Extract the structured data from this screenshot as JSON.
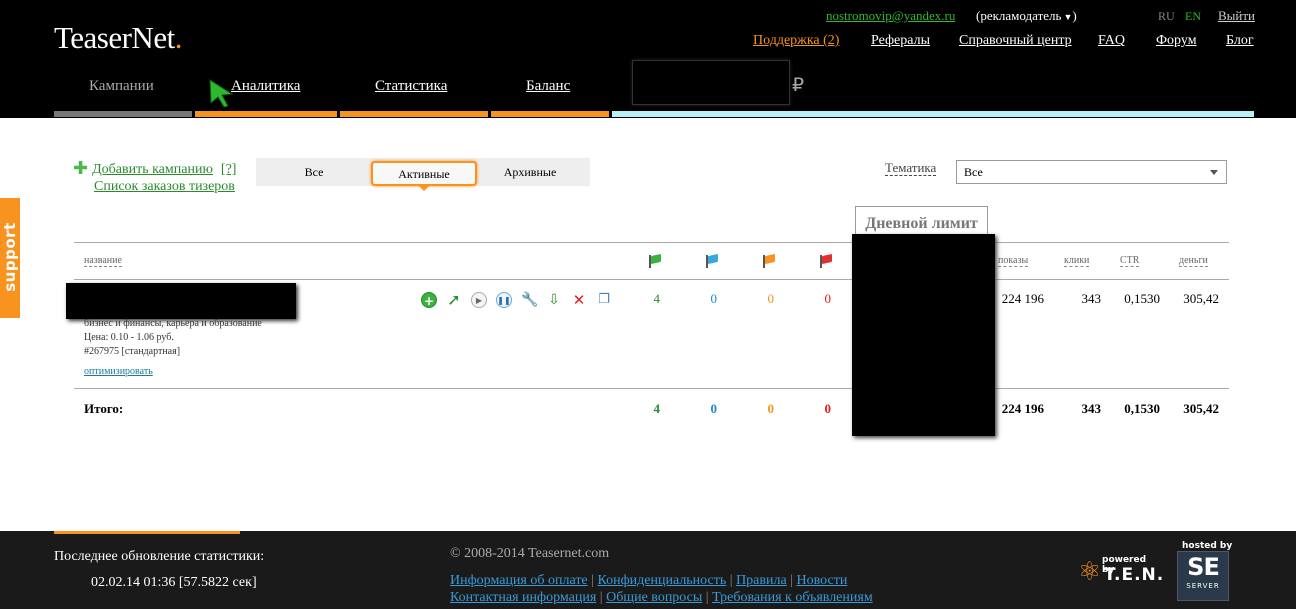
{
  "header": {
    "logo": "TeaserNet",
    "logo_dot": ".",
    "user_email": "nostromovip@yandex.ru",
    "role": "рекламодатель",
    "lang_ru": "RU",
    "lang_en": "EN",
    "logout": "Выйти",
    "top_nav": {
      "support": "Поддержка (2)",
      "referrals": "Рефералы",
      "help_center": "Справочный центр",
      "faq": "FAQ",
      "forum": "Форум",
      "blog": "Блог"
    },
    "tabs": {
      "campaigns": "Кампании",
      "analytics": "Аналитика",
      "statistics": "Статистика",
      "balance": "Баланс"
    },
    "currency_sign": "₽"
  },
  "support_tab": "support",
  "toolbar": {
    "add_campaign": "Добавить кампанию",
    "help": "[?]",
    "teaser_orders": "Список заказов тизеров",
    "filters": {
      "all": "Все",
      "active": "Активные",
      "archive": "Архивные"
    },
    "topic_label": "Тематика",
    "topic_value": "Все"
  },
  "table": {
    "daily_limit_header": "Дневной лимит",
    "columns": {
      "name": "название",
      "shows": "показы",
      "clicks": "клики",
      "ctr": "CTR",
      "money": "деньги"
    },
    "row": {
      "topic": "бизнес и финансы, карьера и образование",
      "price": "Цена: 0.10 - 1.06 руб.",
      "id": "#267975 [стандартная]",
      "optimize": "оптимизировать",
      "green": "4",
      "blue": "0",
      "orange": "0",
      "red": "0",
      "shows": "224 196",
      "clicks": "343",
      "ctr": "0,1530",
      "money": "305,42"
    },
    "total": {
      "label": "Итого:",
      "green": "4",
      "blue": "0",
      "orange": "0",
      "red": "0",
      "shows": "224 196",
      "clicks": "343",
      "ctr": "0,1530",
      "money": "305,42"
    }
  },
  "footer": {
    "last_update_label": "Последнее обновление статистики:",
    "last_update_value": "02.02.14 01:36 [57.5822 сек]",
    "copyright": "© 2008-2014 Teasernet.com",
    "links_row1": [
      "Информация об оплате",
      "Конфиденциальность",
      "Правила",
      "Новости"
    ],
    "links_row2": [
      "Контактная информация",
      "Общие вопросы",
      "Требования к объявлениям"
    ],
    "powered_small": "powered by",
    "powered_ten": "T.E.N.",
    "hosted_by": "hosted by",
    "server_big": "SE",
    "server_small": "SERVER"
  },
  "colors": {
    "accent": "#f7931e",
    "green": "#2a8b2a",
    "blue": "#1a8ac8",
    "red": "#e02020",
    "header_bg": "#000000"
  }
}
